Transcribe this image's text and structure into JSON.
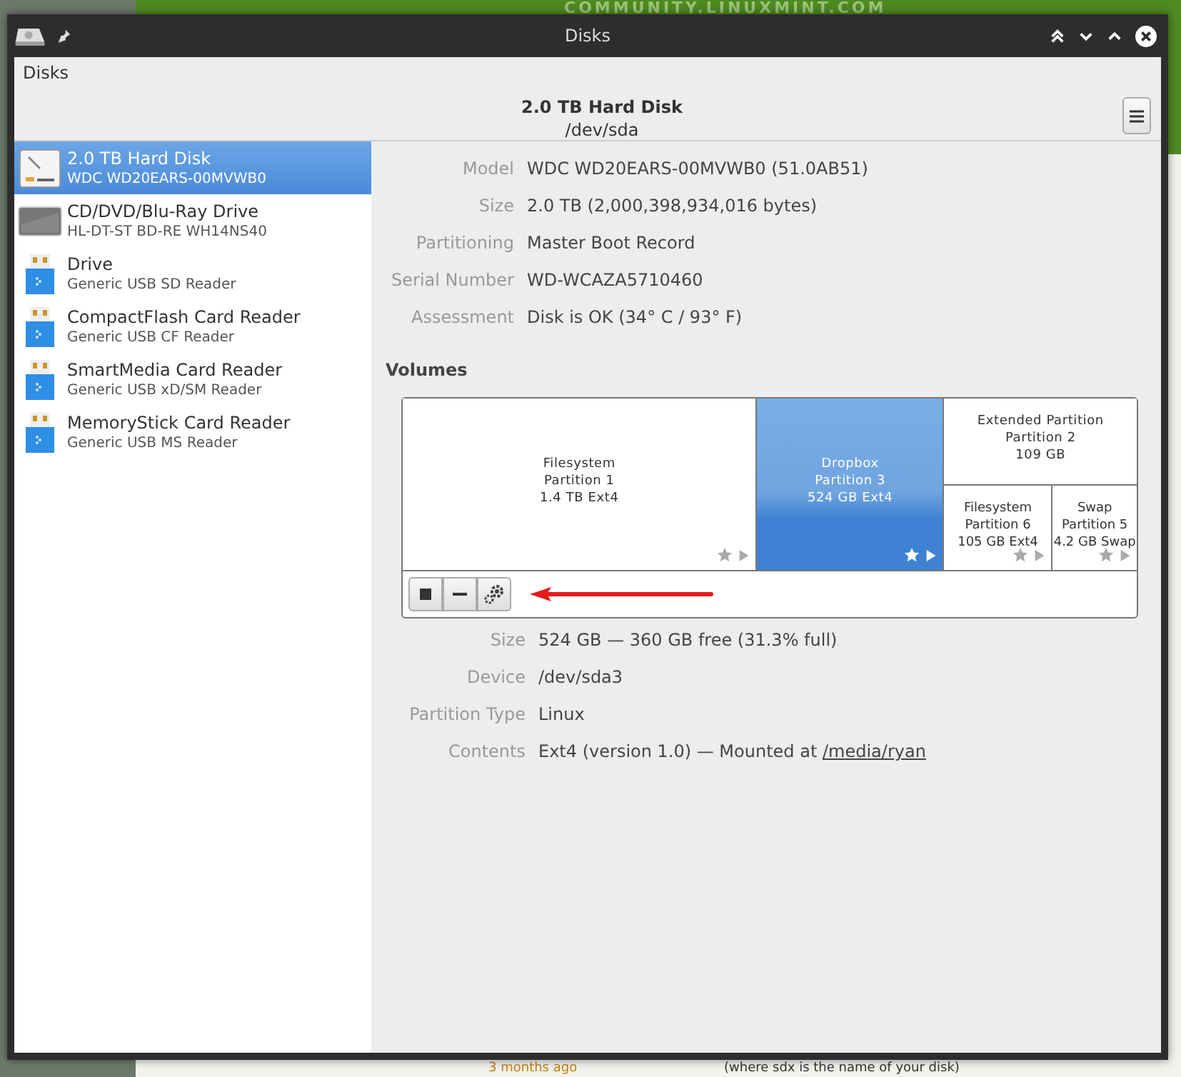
{
  "background_page": {
    "banner": "COMMUNITY.LINUXMINT.COM",
    "bottom_time": "3 months ago",
    "bottom_text": "(where sdx is the name of your disk)"
  },
  "window": {
    "title": "Disks"
  },
  "header": {
    "app_label": "Disks",
    "title": "2.0 TB Hard Disk",
    "subtitle": "/dev/sda"
  },
  "sidebar": {
    "items": [
      {
        "kind": "harddisk",
        "name": "2.0 TB Hard Disk",
        "detail": "WDC WD20EARS-00MVWB0",
        "selected": true
      },
      {
        "kind": "optical",
        "name": "CD/DVD/Blu-Ray Drive",
        "detail": "HL-DT-ST BD-RE  WH14NS40",
        "selected": false
      },
      {
        "kind": "card_reader",
        "name": "Drive",
        "detail": "Generic USB SD Reader",
        "selected": false
      },
      {
        "kind": "card_reader",
        "name": "CompactFlash Card Reader",
        "detail": "Generic USB CF Reader",
        "selected": false
      },
      {
        "kind": "card_reader",
        "name": "SmartMedia Card Reader",
        "detail": "Generic USB xD/SM Reader",
        "selected": false
      },
      {
        "kind": "card_reader",
        "name": "MemoryStick Card Reader",
        "detail": "Generic USB MS Reader",
        "selected": false
      }
    ]
  },
  "disk_details": [
    {
      "label": "Model",
      "value": "WDC WD20EARS-00MVWB0 (51.0AB51)"
    },
    {
      "label": "Size",
      "value": "2.0 TB (2,000,398,934,016 bytes)"
    },
    {
      "label": "Partitioning",
      "value": "Master Boot Record"
    },
    {
      "label": "Serial Number",
      "value": "WD-WCAZA5710460"
    },
    {
      "label": "Assessment",
      "value": "Disk is OK (34° C / 93° F)"
    }
  ],
  "volumes": {
    "heading": "Volumes",
    "partitions": [
      {
        "lines": [
          "Filesystem",
          "Partition 1",
          "1.4 TB Ext4"
        ],
        "selected": false
      },
      {
        "lines": [
          "Dropbox",
          "Partition 3",
          "524 GB Ext4"
        ],
        "selected": true
      },
      {
        "lines": [
          "Extended Partition",
          "Partition 2",
          "109 GB"
        ],
        "selected": false,
        "children": [
          {
            "lines": [
              "Filesystem",
              "Partition 6",
              "105 GB Ext4"
            ],
            "selected": false
          },
          {
            "lines": [
              "Swap",
              "Partition 5",
              "4.2 GB Swap"
            ],
            "selected": false
          }
        ]
      }
    ],
    "toolbar": [
      {
        "kind": "stop"
      },
      {
        "kind": "delete"
      },
      {
        "kind": "settings"
      }
    ]
  },
  "volume_details": [
    {
      "label": "Size",
      "value": "524 GB — 360 GB free (31.3% full)"
    },
    {
      "label": "Device",
      "value": "/dev/sda3"
    },
    {
      "label": "Partition Type",
      "value": "Linux"
    },
    {
      "label": "Contents",
      "value": "Ext4 (version 1.0) — Mounted at",
      "link": "/media/ryan"
    }
  ]
}
